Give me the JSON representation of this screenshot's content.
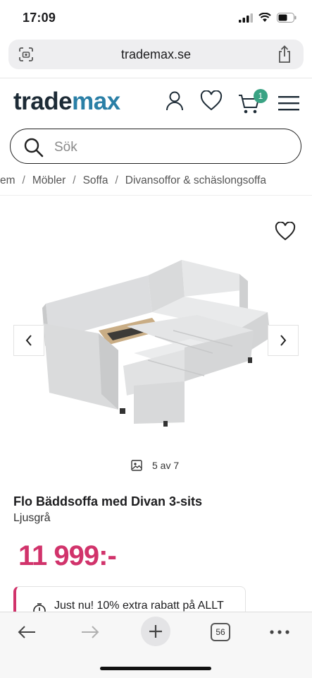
{
  "status_bar": {
    "time": "17:09"
  },
  "browser": {
    "url": "trademax.se"
  },
  "header": {
    "logo_part1": "trade",
    "logo_part2": "max",
    "cart_count": "1"
  },
  "search": {
    "placeholder": "Sök"
  },
  "breadcrumb": {
    "items": [
      "em",
      "Möbler",
      "Soffa",
      "Divansoffor & schäslongsoffa"
    ],
    "separator": "/"
  },
  "gallery": {
    "counter": "5 av 7"
  },
  "product": {
    "name": "Flo Bäddsoffa med Divan 3-sits",
    "color": "Ljusgrå",
    "price": "11 999:-"
  },
  "promo": {
    "text": "Just nu! 10% extra rabatt på ALLT"
  },
  "toolbar": {
    "tabs_count": "56"
  },
  "colors": {
    "brand_dark": "#1d2b36",
    "brand_blue": "#2a7fa6",
    "price_pink": "#d1336b",
    "badge_green": "#3aa384"
  }
}
